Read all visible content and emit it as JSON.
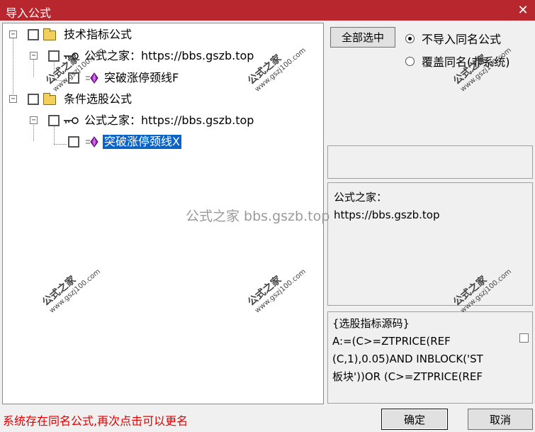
{
  "window": {
    "title": "导入公式",
    "close_glyph": "✕"
  },
  "tree": {
    "nodes": [
      {
        "label": "技术指标公式",
        "icon": "folder-icon",
        "checked": false,
        "expanded": true,
        "selected": false
      },
      {
        "label": "公式之家：https://bbs.gszb.top",
        "icon": "key-icon",
        "checked": false,
        "expanded": true,
        "selected": false
      },
      {
        "label": "突破涨停颈线F",
        "icon": "formula-gem-icon",
        "checked": false,
        "selected": false
      },
      {
        "label": "条件选股公式",
        "icon": "folder-icon",
        "checked": false,
        "expanded": true,
        "selected": false
      },
      {
        "label": "公式之家：https://bbs.gszb.top",
        "icon": "key-icon",
        "checked": false,
        "expanded": true,
        "selected": false
      },
      {
        "label": "突破涨停颈线X",
        "icon": "formula-gem-icon",
        "checked": false,
        "selected": true
      }
    ],
    "expander_glyph": "−"
  },
  "controls": {
    "select_all_label": "全部选中",
    "radio_no_import_same": "不导入同名公式",
    "radio_overwrite_same": "覆盖同名(非系统)",
    "selected_radio": "no_import_same"
  },
  "info": {
    "line1": "公式之家：",
    "line2": "https://bbs.gszb.top"
  },
  "source": {
    "header": "{选股指标源码}",
    "line1": "A:=(C>=ZTPRICE(REF",
    "line2": "(C,1),0.05)AND INBLOCK('ST",
    "line3": "板块'))OR (C>=ZTPRICE(REF"
  },
  "footer": {
    "status_message": "系统存在同名公式,再次点击可以更名",
    "ok_label": "确定",
    "cancel_label": "取消"
  },
  "watermarks": {
    "stamp_title": "公式之家",
    "stamp_url": "www.gszj100.com",
    "center_text": "公式之家 bbs.gszb.top"
  },
  "colors": {
    "titlebar": "#b8272d",
    "selection": "#0a64c8",
    "status_text": "#e00000"
  }
}
